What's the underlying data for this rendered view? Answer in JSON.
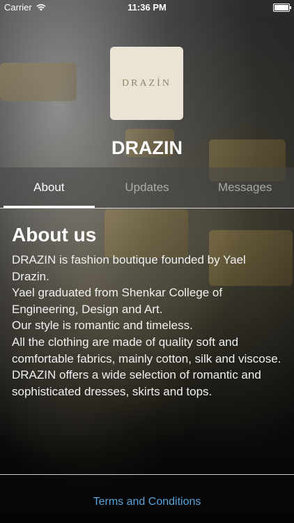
{
  "status_bar": {
    "carrier": "Carrier",
    "time": "11:36 PM"
  },
  "header": {
    "logo_text": "DRAZİN",
    "title": "DRAZIN"
  },
  "tabs": [
    {
      "label": "About",
      "active": true
    },
    {
      "label": "Updates",
      "active": false
    },
    {
      "label": "Messages",
      "active": false
    }
  ],
  "about": {
    "heading": "About us",
    "paragraphs": [
      "DRAZIN is fashion boutique founded by Yael Drazin.",
      "Yael graduated from Shenkar College of Engineering, Design and Art.",
      "Our style is romantic and timeless.",
      "All the clothing are made of quality soft and comfortable fabrics, mainly cotton, silk and viscose.",
      "DRAZIN offers a wide selection of romantic and sophisticated dresses, skirts and tops."
    ]
  },
  "footer": {
    "link_label": "Terms and Conditions",
    "link_color": "#5ba3d9"
  }
}
